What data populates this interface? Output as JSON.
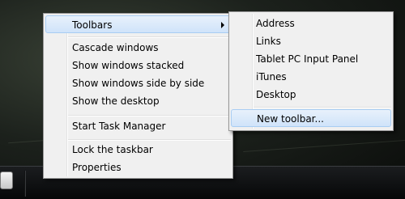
{
  "context_menu": {
    "items": [
      {
        "label": "Toolbars"
      },
      {
        "label": "Cascade windows"
      },
      {
        "label": "Show windows stacked"
      },
      {
        "label": "Show windows side by side"
      },
      {
        "label": "Show the desktop"
      },
      {
        "label": "Start Task Manager"
      },
      {
        "label": "Lock the taskbar"
      },
      {
        "label": "Properties"
      }
    ]
  },
  "toolbars_submenu": {
    "items": [
      {
        "label": "Address"
      },
      {
        "label": "Links"
      },
      {
        "label": "Tablet PC Input Panel"
      },
      {
        "label": "iTunes"
      },
      {
        "label": "Desktop"
      },
      {
        "label": "New toolbar..."
      }
    ]
  },
  "taskbar": {
    "icon": "chat-bubble-icon"
  }
}
